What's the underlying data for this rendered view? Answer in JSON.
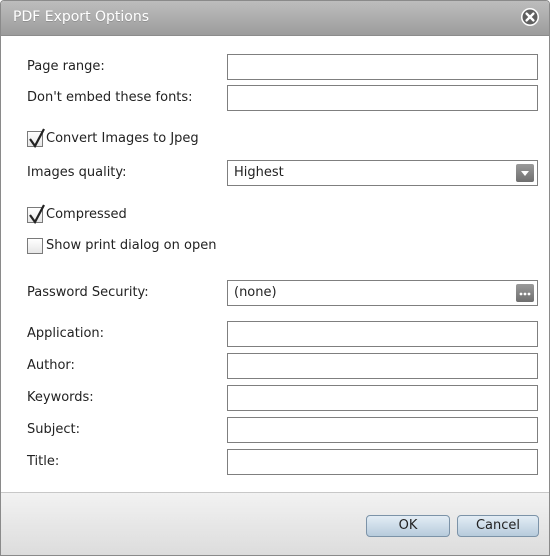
{
  "dialog": {
    "title": "PDF Export Options",
    "close_icon": "close-circle-icon"
  },
  "fields": {
    "page_range": {
      "label": "Page range:",
      "value": ""
    },
    "dont_embed_fonts": {
      "label": "Don't embed these fonts:",
      "value": ""
    },
    "convert_images": {
      "label": "Convert Images to Jpeg",
      "checked": true
    },
    "images_quality": {
      "label": "Images quality:",
      "value": "Highest",
      "icon": "dropdown-arrow-icon"
    },
    "compressed": {
      "label": "Compressed",
      "checked": true
    },
    "show_print_dialog": {
      "label": "Show print dialog on open",
      "checked": false
    },
    "password_security": {
      "label": "Password Security:",
      "value": "(none)",
      "icon": "ellipsis-icon"
    },
    "application": {
      "label": "Application:",
      "value": ""
    },
    "author": {
      "label": "Author:",
      "value": ""
    },
    "keywords": {
      "label": "Keywords:",
      "value": ""
    },
    "subject": {
      "label": "Subject:",
      "value": ""
    },
    "title": {
      "label": "Title:",
      "value": ""
    }
  },
  "buttons": {
    "ok": "OK",
    "cancel": "Cancel"
  },
  "colors": {
    "titlebar": "#a9a9a9",
    "button_fill": "#c9d9e7",
    "footer": "#e6e6e6"
  }
}
